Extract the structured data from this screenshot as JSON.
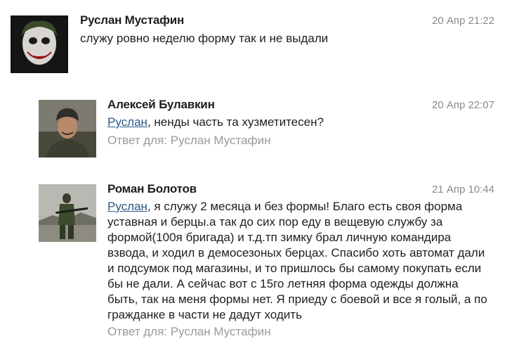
{
  "comments": [
    {
      "author": "Руслан Мустафин",
      "time": "20 Апр 21:22",
      "text": "служу ровно неделю форму так и не выдали",
      "avatar_icon": "joker-avatar"
    },
    {
      "author": "Алексей Булавкин",
      "time": "20 Апр 22:07",
      "mention": "Руслан",
      "text": ", ненды часть та хузметитесен?",
      "reply_to": "Ответ для: Руслан Мустафин",
      "avatar_icon": "man-in-hat-avatar"
    },
    {
      "author": "Роман Болотов",
      "time": "21 Апр 10:44",
      "mention": "Руслан",
      "text": ", я служу 2 месяца и без формы! Благо есть своя форма уставная и берцы.а так до сих пор еду в вещевую службу за формой(100я бригада) и т.д.тп зимку брал личную командира взвода, и ходил в демосезоных берцах. Спасибо хоть автомат дали и подсумок под магазины, и то пришлось бы самому покупать если бы не дали. А сейчас вот с 15го летняя форма одежды должна быть, так на меня формы нет. Я приеду с боевой и все я голый, а по гражданке в части не дадут ходить",
      "reply_to": "Ответ для: Руслан Мустафин",
      "avatar_icon": "soldier-with-rifle-avatar"
    }
  ],
  "colors": {
    "mention": "#2a5885",
    "timestamp": "#8a8a8a",
    "reply_to": "#9a9a9a"
  }
}
